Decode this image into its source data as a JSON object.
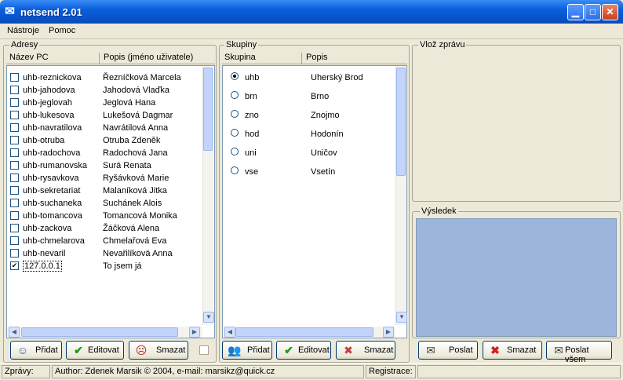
{
  "window": {
    "title": "netsend 2.01"
  },
  "menu": {
    "items": [
      "Nástroje",
      "Pomoc"
    ]
  },
  "addresses": {
    "group_label": "Adresy",
    "col_name": "Název PC",
    "col_desc": "Popis (jméno uživatele)",
    "rows": [
      {
        "pc": "uhb-reznickova",
        "user": "Řezníčková Marcela",
        "checked": false
      },
      {
        "pc": "uhb-jahodova",
        "user": "Jahodová Vlaďka",
        "checked": false
      },
      {
        "pc": "uhb-jeglovah",
        "user": "Jeglová Hana",
        "checked": false
      },
      {
        "pc": "uhb-lukesova",
        "user": "Lukešová Dagmar",
        "checked": false
      },
      {
        "pc": "uhb-navratilova",
        "user": "Navrátilová Anna",
        "checked": false
      },
      {
        "pc": "uhb-otruba",
        "user": "Otruba Zdeněk",
        "checked": false
      },
      {
        "pc": "uhb-radochova",
        "user": "Radochová Jana",
        "checked": false
      },
      {
        "pc": "uhb-rumanovska",
        "user": "Surá Renata",
        "checked": false
      },
      {
        "pc": "uhb-rysavkova",
        "user": "Ryšávková Marie",
        "checked": false
      },
      {
        "pc": "uhb-sekretariat",
        "user": "Malaníková Jitka",
        "checked": false
      },
      {
        "pc": "uhb-suchaneka",
        "user": "Suchánek Alois",
        "checked": false
      },
      {
        "pc": "uhb-tomancova",
        "user": "Tomancová Monika",
        "checked": false
      },
      {
        "pc": "uhb-zackova",
        "user": "Žáčková Alena",
        "checked": false
      },
      {
        "pc": "uhb-chmelarova",
        "user": "Chmelařová Eva",
        "checked": false
      },
      {
        "pc": "uhb-nevaril",
        "user": "Nevařilíková Anna",
        "checked": false
      },
      {
        "pc": "127.0.0.1",
        "user": "To jsem já",
        "checked": true
      }
    ],
    "btn_add": "Přidat",
    "btn_edit": "Editovat",
    "btn_delete": "Smazat"
  },
  "groups": {
    "group_label": "Skupiny",
    "col_group": "Skupina",
    "col_desc": "Popis",
    "rows": [
      {
        "name": "uhb",
        "desc": "Uherský Brod",
        "selected": true
      },
      {
        "name": "brn",
        "desc": "Brno",
        "selected": false
      },
      {
        "name": "zno",
        "desc": "Znojmo",
        "selected": false
      },
      {
        "name": "hod",
        "desc": "Hodonín",
        "selected": false
      },
      {
        "name": "uni",
        "desc": "Uničov",
        "selected": false
      },
      {
        "name": "vse",
        "desc": "Vsetín",
        "selected": false
      }
    ],
    "btn_add": "Přidat",
    "btn_edit": "Editovat",
    "btn_delete": "Smazat"
  },
  "message": {
    "group_label": "Vlož zprávu",
    "value": ""
  },
  "result": {
    "group_label": "Výsledek"
  },
  "send": {
    "btn_send": "Poslat",
    "btn_delete": "Smazat",
    "btn_send_all": "Poslat všem"
  },
  "status": {
    "label": "Zprávy:",
    "author": "Author: Zdenek Marsik © 2004, e-mail: marsikz@quick.cz",
    "registration": "Registrace:"
  },
  "colors": {
    "title_bar": "#0a5fdc",
    "result_bg": "#9db4dc",
    "window_bg": "#ece9d8"
  }
}
